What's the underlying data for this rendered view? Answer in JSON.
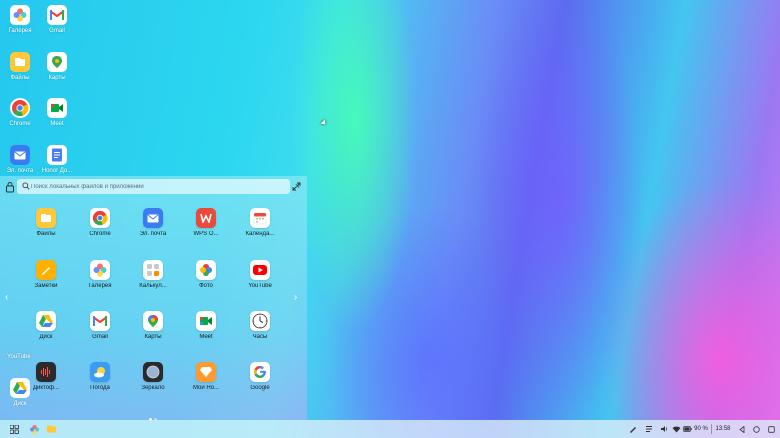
{
  "desktop": {
    "icons": [
      {
        "label": "Галерея",
        "icon": "gallery-icon"
      },
      {
        "label": "Gmail",
        "icon": "gmail-icon"
      },
      {
        "label": "Файлы",
        "icon": "files-icon"
      },
      {
        "label": "Карты",
        "icon": "maps-icon"
      },
      {
        "label": "Chrome",
        "icon": "chrome-icon"
      },
      {
        "label": "Meet",
        "icon": "meet-icon"
      },
      {
        "label": "Эл. почта",
        "icon": "email-icon"
      },
      {
        "label": "Honor До...",
        "icon": "docs-icon"
      }
    ],
    "side_items": [
      {
        "label": "YouTube"
      },
      {
        "label": "Диск"
      }
    ]
  },
  "launcher": {
    "search_placeholder": "Поиск локальных файлов и приложений",
    "apps": [
      {
        "label": "Файлы",
        "icon": "files-icon"
      },
      {
        "label": "Chrome",
        "icon": "chrome-icon"
      },
      {
        "label": "Эл. почта",
        "icon": "email-icon"
      },
      {
        "label": "WPS O...",
        "icon": "wps-office-icon"
      },
      {
        "label": "Календа...",
        "icon": "calendar-icon"
      },
      {
        "label": "Заметки",
        "icon": "notes-icon"
      },
      {
        "label": "Галерея",
        "icon": "gallery-icon"
      },
      {
        "label": "Калькул...",
        "icon": "calculator-icon"
      },
      {
        "label": "Фото",
        "icon": "photos-icon"
      },
      {
        "label": "YouTube",
        "icon": "youtube-icon"
      },
      {
        "label": "Диск",
        "icon": "drive-icon"
      },
      {
        "label": "Gmail",
        "icon": "gmail-icon"
      },
      {
        "label": "Карты",
        "icon": "maps-icon"
      },
      {
        "label": "Meet",
        "icon": "meet-icon"
      },
      {
        "label": "Часы",
        "icon": "clock-icon"
      },
      {
        "label": "Диктоф...",
        "icon": "recorder-icon"
      },
      {
        "label": "Погода",
        "icon": "weather-icon"
      },
      {
        "label": "Зеркало",
        "icon": "mirror-icon"
      },
      {
        "label": "Мой Но...",
        "icon": "my-honor-icon"
      },
      {
        "label": "Google",
        "icon": "google-icon"
      }
    ],
    "page_dots": 2
  },
  "taskbar": {
    "battery": "90 %",
    "time": "13:58"
  },
  "colors": {
    "files": "#ffc83a",
    "chrome_red": "#ea4335",
    "chrome_green": "#34a853",
    "chrome_yellow": "#fbbc05",
    "chrome_blue": "#4285f4",
    "email": "#3a7bf0",
    "wps": "#e84a3b",
    "youtube": "#ff0000",
    "notes": "#ffb000",
    "meet_green": "#00ac47"
  }
}
